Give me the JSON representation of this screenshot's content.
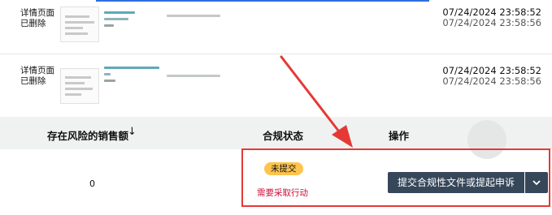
{
  "rows": [
    {
      "status_line1": "详情页面",
      "status_line2": "已删除",
      "date_primary": "07/24/2024 23:58:52",
      "date_secondary": "07/24/2024 23:58:56"
    },
    {
      "status_line1": "详情页面",
      "status_line2": "已删除",
      "date_primary": "07/24/2024 23:58:52",
      "date_secondary": "07/24/2024 23:58:56"
    }
  ],
  "table": {
    "headers": {
      "sales_at_risk": "存在风险的销售额",
      "sort_icon": "↓",
      "compliance_status": "合规状态",
      "actions": "操作"
    },
    "row": {
      "sales_value": "0",
      "status_badge": "未提交",
      "action_needed": "需要采取行动",
      "cta_label": "提交合规性文件或提起申诉"
    }
  },
  "colors": {
    "badge_bg": "#ffc44d",
    "action_text": "#cc0c39",
    "cta_bg": "#37475a",
    "annotation_red": "#e53935",
    "header_bg": "#f0f2f2"
  },
  "icons": {
    "sort": "arrow-down-icon",
    "dropdown": "chevron-down-icon"
  }
}
